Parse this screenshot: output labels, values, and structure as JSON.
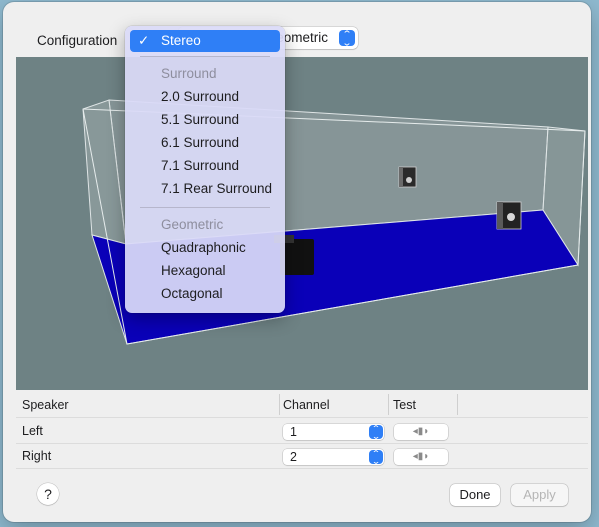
{
  "toolbar": {
    "configuration_label": "Configuration",
    "configuration_value": "eometric"
  },
  "menu": {
    "selected": "Stereo",
    "checkmark": "✓",
    "sections": [
      {
        "header": "Surround",
        "items": [
          "2.0 Surround",
          "5.1 Surround",
          "6.1 Surround",
          "7.1 Surround",
          "7.1 Rear Surround"
        ]
      },
      {
        "header": "Geometric",
        "items": [
          "Quadraphonic",
          "Hexagonal",
          "Octagonal"
        ]
      }
    ]
  },
  "speakers_table": {
    "headers": [
      "Speaker",
      "Channel",
      "Test"
    ],
    "rows": [
      {
        "speaker": "Left",
        "channel": "1"
      },
      {
        "speaker": "Right",
        "channel": "2"
      }
    ]
  },
  "buttons": {
    "help": "?",
    "done": "Done",
    "apply": "Apply"
  },
  "icons": {
    "stepper": "up-down-chevron-icon",
    "test": "speaker-wave-icon"
  },
  "colors": {
    "accent": "#2f7ff6",
    "floor": "#0a00b8",
    "scene_background": "#6e8284"
  }
}
